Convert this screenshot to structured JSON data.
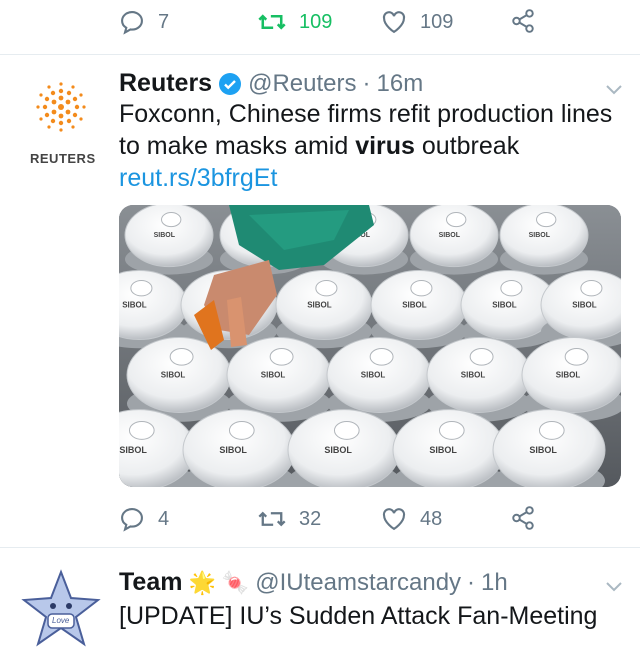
{
  "top_tweet": {
    "reply_count": "7",
    "retweet_count": "109",
    "like_count": "109",
    "retweet_color": "#17bf63"
  },
  "reuters_tweet": {
    "name": "Reuters",
    "handle": "@Reuters",
    "separator": "·",
    "time": "16m",
    "logo_text": "REUTERS",
    "text_before": "Foxconn, Chinese firms refit production lines to make masks amid ",
    "text_bold": "virus",
    "text_after": " outbreak ",
    "link": "reut.rs/3bfrgEt",
    "mask_brand": "SIBOL",
    "reply_count": "4",
    "retweet_count": "32",
    "like_count": "48"
  },
  "team_tweet": {
    "name": "Team",
    "emoji_1": "🌟",
    "emoji_2": "🍬",
    "handle": "@IUteamstarcandy",
    "separator": "·",
    "time": "1h",
    "avatar_text": "Love",
    "text": "[UPDATE] IU’s Sudden Attack Fan-Meeting"
  },
  "colors": {
    "verified": "#1da1f2",
    "link": "#1b95e0",
    "muted": "#657786",
    "reuters_orange": "#f38b1c"
  }
}
